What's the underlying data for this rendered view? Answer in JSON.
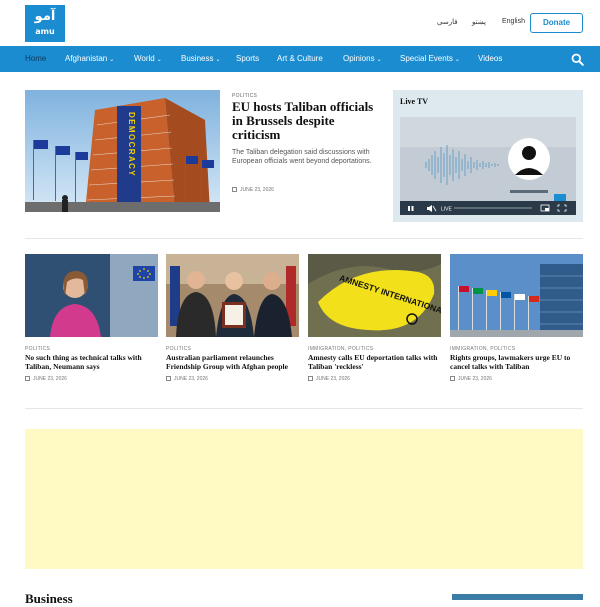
{
  "header": {
    "logo_ar": "آمو",
    "logo_en": "amu",
    "languages": [
      "فارسی",
      "پښتو",
      "English"
    ],
    "donate_label": "Donate"
  },
  "nav": {
    "items": [
      {
        "label": "Home"
      },
      {
        "label": "Afghanistan",
        "chevron": "⌄"
      },
      {
        "label": "World",
        "chevron": "⌄"
      },
      {
        "label": "Business",
        "chevron": "⌄"
      },
      {
        "label": "Sports"
      },
      {
        "label": "Art & Culture"
      },
      {
        "label": "Opinions",
        "chevron": "⌄"
      },
      {
        "label": "Special Events",
        "chevron": "⌄"
      },
      {
        "label": "Videos"
      }
    ],
    "search_icon": "search-icon"
  },
  "hero": {
    "image_text": "DEMOCRACY",
    "category": "POLITICS",
    "title": "EU hosts Taliban officials in Brussels despite criticism",
    "summary": "The Taliban delegation said discussions with European officials went beyond deportations.",
    "date": "JUNE 23, 2026"
  },
  "live": {
    "label": "Live TV",
    "controls": [
      "pause-icon",
      "mute-icon",
      "LIVE",
      "pip-icon",
      "fullscreen-icon"
    ],
    "live_text": "LIVE"
  },
  "cards": [
    {
      "category": "POLITICS",
      "title": "No such thing as technical talks with Taliban, Neumann says",
      "date": "JUNE 23, 2026"
    },
    {
      "category": "POLITICS",
      "title": "Australian parliament relaunches Friendship Group with Afghan people",
      "date": "JUNE 23, 2026"
    },
    {
      "category": "IMMIGRATION, POLITICS",
      "title": "Amnesty calls EU deportation talks with Taliban 'reckless'",
      "date": "JUNE 23, 2026",
      "image_text": "AMNESTY INTERNATIONAL"
    },
    {
      "category": "IMMIGRATION, POLITICS",
      "title": "Rights groups, lawmakers urge EU to cancel talks with Taliban",
      "date": "JUNE 23, 2026"
    }
  ],
  "sections": {
    "business_title": "Business"
  },
  "colors": {
    "brand_blue": "#1a8ccf",
    "nav_active": "#123a5e",
    "ad_yellow": "#fff9c4",
    "live_panel": "#dde8ef"
  }
}
